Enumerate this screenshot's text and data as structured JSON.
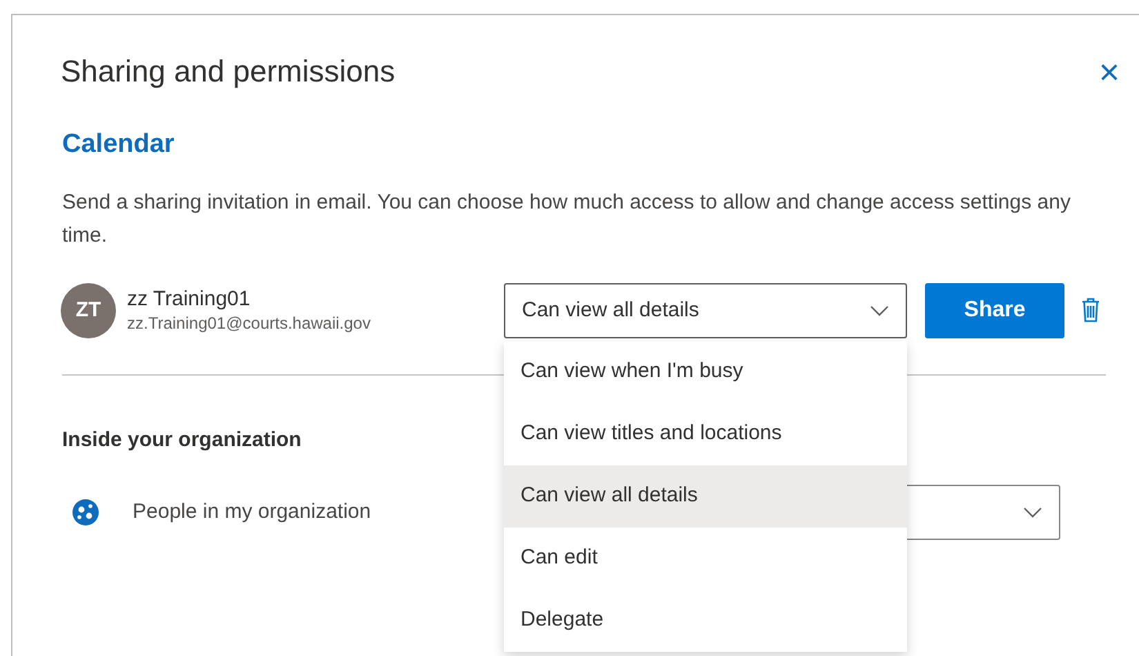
{
  "dialog": {
    "title": "Sharing and permissions",
    "close": "×"
  },
  "calendar_name": "Calendar",
  "description": "Send a sharing invitation in email. You can choose how much access to allow and change access settings any time.",
  "invitee": {
    "initials": "ZT",
    "name": "zz Training01",
    "email": "zz.Training01@courts.hawaii.gov",
    "permission": "Can view all details",
    "expanded": true
  },
  "share_button": "Share",
  "permission_options": [
    {
      "label": "Can view when I'm busy",
      "selected": false
    },
    {
      "label": "Can view titles and locations",
      "selected": false
    },
    {
      "label": "Can view all details",
      "selected": true
    },
    {
      "label": "Can edit",
      "selected": false
    },
    {
      "label": "Delegate",
      "selected": false
    }
  ],
  "organization_section": {
    "heading": "Inside your organization",
    "entries": [
      {
        "name": "People in my organization"
      }
    ]
  }
}
